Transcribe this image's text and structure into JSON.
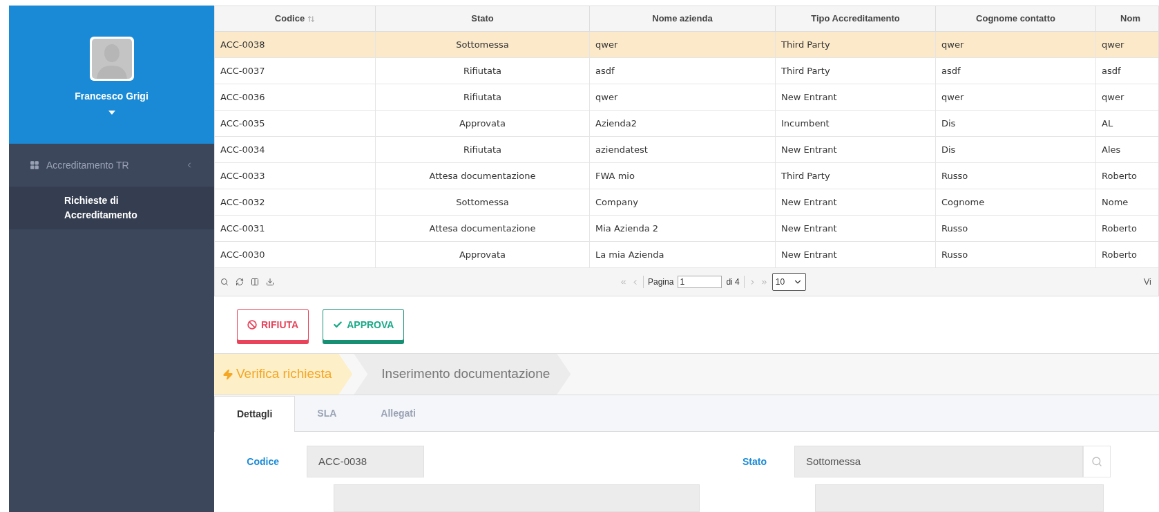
{
  "sidebar": {
    "user_name": "Francesco Grigi",
    "menu": [
      {
        "label": "Accreditamento TR",
        "expanded": true,
        "children": [
          {
            "label": "Richieste di Accreditamento",
            "selected": true
          }
        ]
      }
    ]
  },
  "table": {
    "columns": [
      {
        "label": "Codice",
        "sortable": true
      },
      {
        "label": "Stato",
        "sortable": false
      },
      {
        "label": "Nome azienda",
        "sortable": false
      },
      {
        "label": "Tipo Accreditamento",
        "sortable": false
      },
      {
        "label": "Cognome contatto",
        "sortable": false
      },
      {
        "label": "Nom",
        "sortable": false
      }
    ],
    "rows": [
      {
        "selected": true,
        "cells": [
          "ACC-0038",
          "Sottomessa",
          "qwer",
          "Third Party",
          "qwer",
          "qwer"
        ]
      },
      {
        "selected": false,
        "cells": [
          "ACC-0037",
          "Rifiutata",
          "asdf",
          "Third Party",
          "asdf",
          "asdf"
        ]
      },
      {
        "selected": false,
        "cells": [
          "ACC-0036",
          "Rifiutata",
          "qwer",
          "New Entrant",
          "qwer",
          "qwer"
        ]
      },
      {
        "selected": false,
        "cells": [
          "ACC-0035",
          "Approvata",
          "Azienda2",
          "Incumbent",
          "Dis",
          "AL"
        ]
      },
      {
        "selected": false,
        "cells": [
          "ACC-0034",
          "Rifiutata",
          "aziendatest",
          "New Entrant",
          "Dis",
          "Ales"
        ]
      },
      {
        "selected": false,
        "cells": [
          "ACC-0033",
          "Attesa documentazione",
          "FWA mio",
          "Third Party",
          "Russo",
          "Roberto"
        ]
      },
      {
        "selected": false,
        "cells": [
          "ACC-0032",
          "Sottomessa",
          "Company",
          "New Entrant",
          "Cognome",
          "Nome"
        ]
      },
      {
        "selected": false,
        "cells": [
          "ACC-0031",
          "Attesa documentazione",
          "Mia Azienda 2",
          "New Entrant",
          "Russo",
          "Roberto"
        ]
      },
      {
        "selected": false,
        "cells": [
          "ACC-0030",
          "Approvata",
          "La mia Azienda",
          "New Entrant",
          "Russo",
          "Roberto"
        ]
      }
    ]
  },
  "pager": {
    "page_label": "Pagina",
    "page": "1",
    "of_label": "di 4",
    "page_size": "10",
    "view_info": "Vi"
  },
  "actions": [
    {
      "kind": "reject",
      "label": "RIFIUTA"
    },
    {
      "kind": "approve",
      "label": "APPROVA"
    }
  ],
  "steps": [
    {
      "label": "Verifica richiesta",
      "selected": true
    },
    {
      "label": "Inserimento documentazione",
      "selected": false
    }
  ],
  "tabs": [
    {
      "label": "Dettagli",
      "selected": true
    },
    {
      "label": "SLA",
      "selected": false
    },
    {
      "label": "Allegati",
      "selected": false
    }
  ],
  "form": {
    "fields": [
      {
        "label": "Codice",
        "value": "ACC-0038",
        "kind": "text"
      },
      {
        "label": "Stato",
        "value": "Sottomessa",
        "kind": "lookup"
      }
    ]
  }
}
